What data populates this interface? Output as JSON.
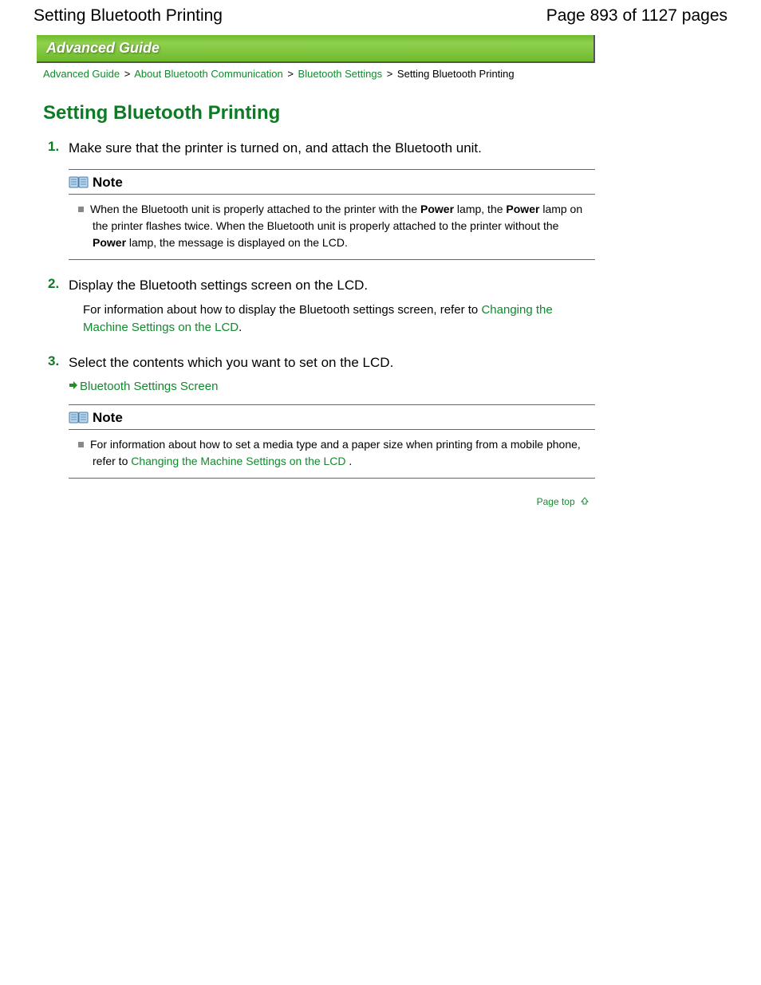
{
  "header": {
    "title": "Setting Bluetooth Printing",
    "page_indicator": "Page 893 of 1127 pages"
  },
  "banner": "Advanced Guide",
  "breadcrumb": {
    "items": [
      {
        "label": "Advanced Guide",
        "link": true
      },
      {
        "label": "About Bluetooth Communication",
        "link": true
      },
      {
        "label": "Bluetooth Settings",
        "link": true
      },
      {
        "label": "Setting Bluetooth Printing",
        "link": false
      }
    ],
    "sep": ">"
  },
  "section_title": "Setting Bluetooth Printing",
  "steps": [
    {
      "num": "1.",
      "text": "Make sure that the printer is turned on, and attach the Bluetooth unit.",
      "note": {
        "label": "Note",
        "body_pre": "When the Bluetooth unit is properly attached to the printer with the ",
        "bold1": "Power",
        "body_mid1": " lamp, the ",
        "bold2": "Power",
        "body_mid2": " lamp on the printer flashes twice. When the Bluetooth unit is properly attached to the printer without the ",
        "bold3": "Power",
        "body_post": " lamp, the message is displayed on the LCD."
      }
    },
    {
      "num": "2.",
      "text": "Display the Bluetooth settings screen on the LCD.",
      "desc_pre": "For information about how to display the Bluetooth settings screen, refer to ",
      "desc_link": "Changing the Machine Settings on the LCD",
      "desc_post": "."
    },
    {
      "num": "3.",
      "text": "Select the contents which you want to set on the LCD.",
      "arrow_link": "Bluetooth Settings Screen",
      "note": {
        "label": "Note",
        "body_pre": "For information about how to set a media type and a paper size when printing from a mobile phone, refer to ",
        "link": "Changing the Machine Settings on the LCD",
        "body_post": " ."
      }
    }
  ],
  "page_top": "Page top"
}
